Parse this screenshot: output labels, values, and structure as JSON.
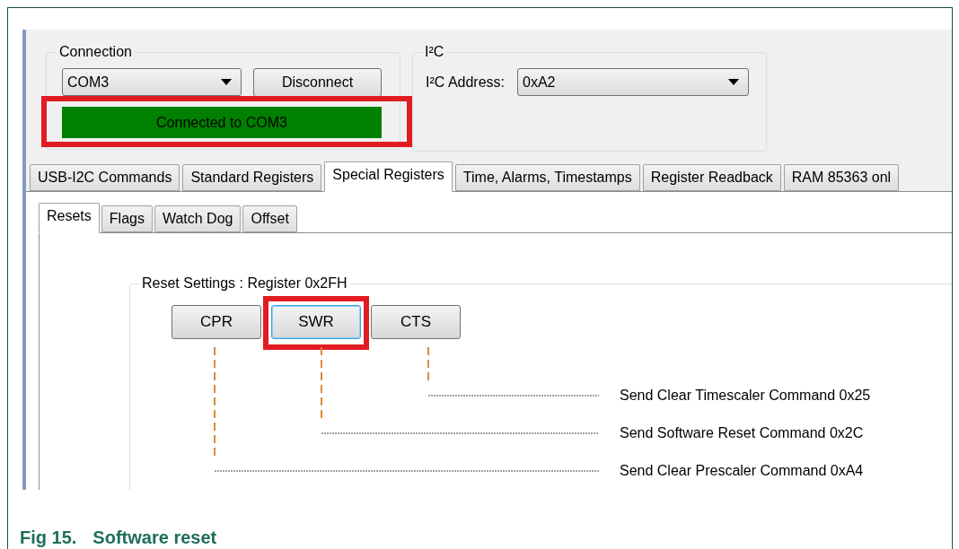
{
  "connection": {
    "title": "Connection",
    "port": {
      "value": "COM3"
    },
    "disconnect_button": "Disconnect",
    "status": {
      "text": "Connected to COM3",
      "connected": true,
      "highlighted": true
    }
  },
  "i2c": {
    "title": "I²C",
    "address_label": "I²C Address:",
    "address": {
      "value": "0xA2"
    }
  },
  "tabs": [
    {
      "label": "USB-I2C Commands",
      "selected": false
    },
    {
      "label": "Standard Registers",
      "selected": false
    },
    {
      "label": "Special Registers",
      "selected": true
    },
    {
      "label": "Time, Alarms, Timestamps",
      "selected": false
    },
    {
      "label": "Register Readback",
      "selected": false
    },
    {
      "label": "RAM 85363 onl",
      "selected": false
    }
  ],
  "subtabs": [
    {
      "label": "Resets",
      "selected": true
    },
    {
      "label": "Flags",
      "selected": false
    },
    {
      "label": "Watch Dog",
      "selected": false
    },
    {
      "label": "Offset",
      "selected": false
    }
  ],
  "reset_settings": {
    "title": "Reset Settings : Register 0x2FH",
    "buttons": [
      {
        "label": "CPR",
        "focused": false,
        "highlighted": false
      },
      {
        "label": "SWR",
        "focused": true,
        "highlighted": true
      },
      {
        "label": "CTS",
        "focused": false,
        "highlighted": false
      }
    ],
    "commands": [
      "Send Clear Timescaler Command 0x25",
      "Send Software Reset Command 0x2C",
      "Send Clear Prescaler Command 0xA4"
    ]
  },
  "caption": {
    "number": "Fig 15.",
    "title": "Software reset"
  }
}
